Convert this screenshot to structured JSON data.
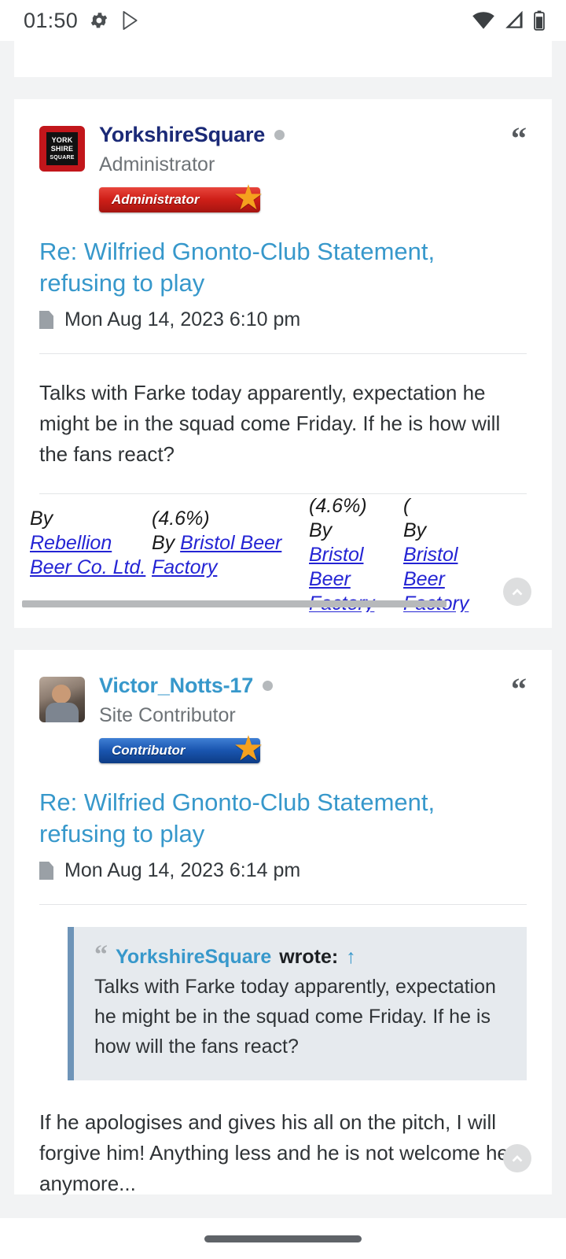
{
  "status_bar": {
    "time": "01:50",
    "left_icons": [
      "gear-icon",
      "play-store-icon"
    ],
    "right_icons": [
      "wifi-icon",
      "cell-signal-icon",
      "battery-icon"
    ]
  },
  "posts": [
    {
      "author": "YorkshireSquare",
      "author_color": "#1b2a77",
      "rank_title": "Administrator",
      "rank_badge": "Administrator",
      "badge_color": "#cf1f18",
      "avatar": "yorkshire-square-logo",
      "avatar_text": [
        "YORK",
        "SHIRE",
        "SQUARE"
      ],
      "online_status": "offline",
      "title": "Re: Wilfried Gnonto-Club Statement, refusing to play",
      "date": "Mon Aug 14, 2023 6:10 pm",
      "body": "Talks with Farke today apparently, expectation he might be in the squad come Friday. If he is how will the fans react?",
      "quote_button": "“",
      "signature_columns": [
        {
          "prefix": "By",
          "link": "Rebellion Beer Co. Ltd."
        },
        {
          "abv": "(4.6%)",
          "prefix": "By",
          "link": "Bristol Beer Factory"
        },
        {
          "abv": "(4.6%)",
          "prefix": "By",
          "link": "Bristol Beer Factory"
        },
        {
          "abv": "(",
          "prefix": "By",
          "link": "Bristol Beer Factory"
        }
      ]
    },
    {
      "author": "Victor_Notts-17",
      "author_color": "#3798cb",
      "rank_title": "Site Contributor",
      "rank_badge": "Contributor",
      "badge_color": "#1a56b0",
      "avatar": "user-photo",
      "online_status": "offline",
      "title": "Re: Wilfried Gnonto-Club Statement, refusing to play",
      "date": "Mon Aug 14, 2023 6:14 pm",
      "quote_button": "“",
      "quoted": {
        "author": "YorkshireSquare",
        "wrote_label": "wrote:",
        "jump_arrow": "↑",
        "text": "Talks with Farke today apparently, expectation he might be in the squad come Friday. If he is how will the fans react?"
      },
      "body": "If he apologises and gives his all on the pitch, I will forgive him! Anything less and he is not welcome here anymore..."
    }
  ],
  "controls": {
    "scroll_top_label": "scroll to top",
    "nav_pill": "home-gesture-pill"
  }
}
